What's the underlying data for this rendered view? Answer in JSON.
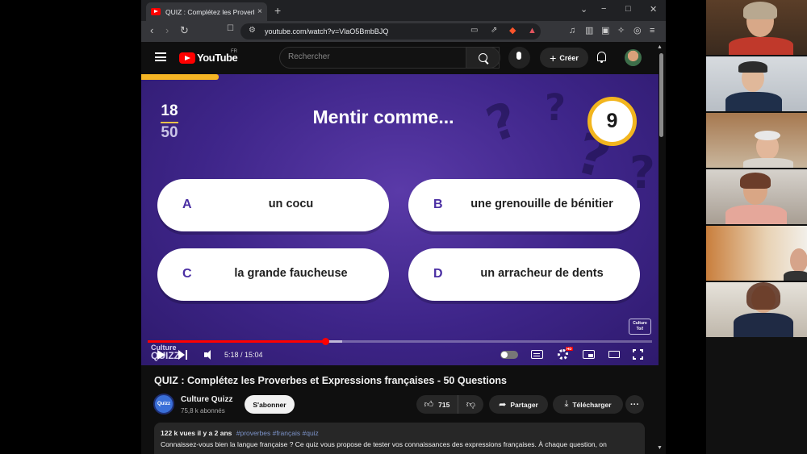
{
  "browser": {
    "tab_title": "QUIZ : Complétez les Proverbes",
    "tab_close": "×",
    "new_tab": "+",
    "url": "youtube.com/watch?v=VlaO5BmbBJQ",
    "win_min": "−",
    "win_max": "□",
    "win_close": "✕",
    "win_menu": "⌄",
    "nav_back": "‹",
    "nav_forward": "›",
    "nav_reload": "↻"
  },
  "youtube": {
    "logo_text": "YouTube",
    "region": "FR",
    "search_placeholder": "Rechercher",
    "create_label": "Créer",
    "create_plus": "+"
  },
  "quiz": {
    "question_number": "18",
    "question_total": "50",
    "question": "Mentir comme...",
    "countdown": "9",
    "timer_fraction": 0.15,
    "answers": [
      {
        "letter": "A",
        "text": "un cocu"
      },
      {
        "letter": "B",
        "text": "une grenouille de bénitier"
      },
      {
        "letter": "C",
        "text": "la grande faucheuse"
      },
      {
        "letter": "D",
        "text": "un arracheur de dents"
      }
    ],
    "brand_corner": "Culture Toi!",
    "watermark_line1": "Culture",
    "watermark_line2": "QUIZZ"
  },
  "player": {
    "current_time": "5:18",
    "duration": "15:04",
    "time_display": "5:18 / 15:04",
    "progress_fraction": 0.352,
    "buffer_fraction": 0.385,
    "hd_badge": "HD"
  },
  "video": {
    "title": "QUIZ : Complétez les Proverbes et Expressions françaises - 50 Questions",
    "channel_name": "Culture Quizz",
    "channel_avatar_text": "Quizz",
    "subscribers": "75,8 k abonnés",
    "subscribe_label": "S'abonner",
    "likes": "715",
    "share_label": "Partager",
    "download_label": "Télécharger",
    "more_label": "···",
    "views_age": "122 k vues  il y a 2 ans",
    "tags": "#proverbes #français #quiz",
    "description": "Connaissez-vous bien la langue française ? Ce quiz vous propose de tester vos connaissances des expressions françaises. À chaque question, on"
  }
}
